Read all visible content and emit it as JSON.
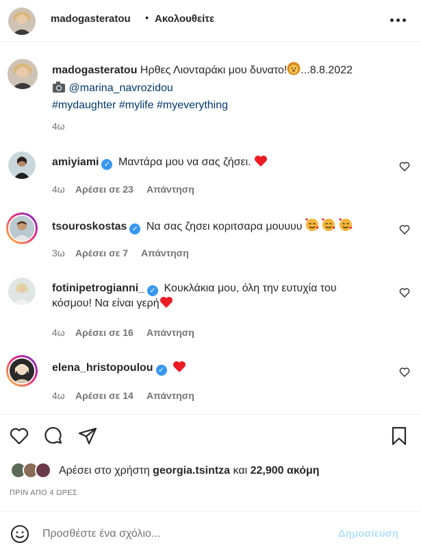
{
  "header": {
    "username": "madogasteratou",
    "separator": "•",
    "follow_status": "Ακολουθείτε"
  },
  "caption": {
    "username": "madogasteratou",
    "text": "Ηρθες Λιονταράκι μου δυνατο!",
    "emoji": "lion-face",
    "date_text": "...8.8.2022",
    "camera_emoji": "camera",
    "mention": "@marina_navrozidou",
    "hashtags": [
      "#mydaughter",
      "#mylife",
      "#myeverything"
    ],
    "time": "4ω"
  },
  "comments": [
    {
      "username": "amiyiami",
      "verified": true,
      "text": "Μαντάρα μου να σας ζήσει.",
      "emojis": [
        "red-heart"
      ],
      "time": "4ω",
      "likes": "Αρέσει σε 23",
      "reply": "Απάντηση"
    },
    {
      "username": "tsouroskostas",
      "verified": true,
      "text": "Να σας ζησει κοριτσαρα μουυυυ",
      "emojis": [
        "smiling-face-with-hearts",
        "smiling-face-with-hearts",
        "smiling-face-with-hearts"
      ],
      "time": "3ω",
      "likes": "Αρέσει σε 7",
      "reply": "Απάντηση"
    },
    {
      "username": "fotinipetrogianni_",
      "verified": true,
      "text_line1": "Κουκλάκια μου, όλη την ευτυχία του",
      "text_line2": "κόσμου! Να είναι γερή",
      "emojis": [
        "red-heart"
      ],
      "time": "4ω",
      "likes": "Αρέσει σε 16",
      "reply": "Απάντηση"
    },
    {
      "username": "elena_hristopoulou",
      "verified": true,
      "text": "",
      "emojis": [
        "red-heart"
      ],
      "time": "4ω",
      "likes": "Αρέσει σε 14",
      "reply": "Απάντηση"
    }
  ],
  "likes": {
    "prefix": "Αρέσει στο χρήστη",
    "user": "georgia.tsintza",
    "conjunction": "και",
    "count_text": "22,900 ακόμη"
  },
  "post_time": "ΠΡΙΝ ΑΠΟ 4 ΩΡΕΣ",
  "comment_box": {
    "placeholder": "Προσθέστε ένα σχόλιο...",
    "post_label": "Δημοσίευση"
  },
  "colors": {
    "link": "#00376b",
    "verified": "#3897f0",
    "secondary_text": "#737373",
    "post_button_disabled": "#b2dffc",
    "heart": "#ed1c24"
  }
}
